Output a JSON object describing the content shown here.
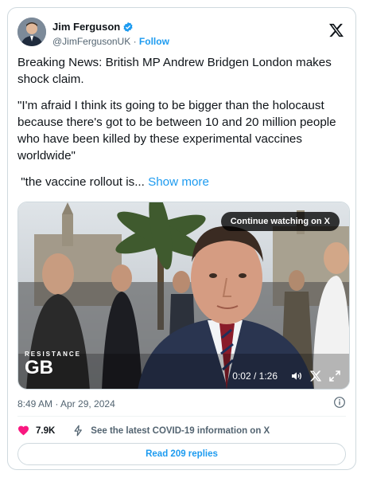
{
  "author": {
    "name": "Jim Ferguson",
    "handle": "@JimFergusonUK",
    "separator": "·",
    "follow_label": "Follow"
  },
  "tweet": {
    "paragraphs": [
      "Breaking News: British MP Andrew Bridgen London makes shock claim.",
      "\"I'm afraid I think its going to be bigger than the holocaust because there's got to be between 10 and 20 million people who have been killed by these experimental vaccines worldwide\""
    ],
    "truncated_text": " \"the vaccine rollout is...",
    "show_more_label": "Show more"
  },
  "video": {
    "continue_label": "Continue watching on X",
    "brand_top": "RESISTANCE",
    "brand_main": "GB",
    "time_display": "0:02 / 1:26"
  },
  "meta": {
    "timestamp": "8:49 AM · Apr 29, 2024"
  },
  "actions": {
    "like_count": "7.9K",
    "covid_label": "See the latest COVID-19 information on X",
    "read_replies_label": "Read 209 replies"
  },
  "colors": {
    "accent": "#1d9bf0",
    "like": "#f91880",
    "text": "#0f1419",
    "muted": "#536471"
  },
  "icons": [
    "verified-badge-icon",
    "x-logo-icon",
    "volume-icon",
    "x-small-icon",
    "fullscreen-icon",
    "info-icon",
    "heart-icon",
    "lightning-icon"
  ]
}
